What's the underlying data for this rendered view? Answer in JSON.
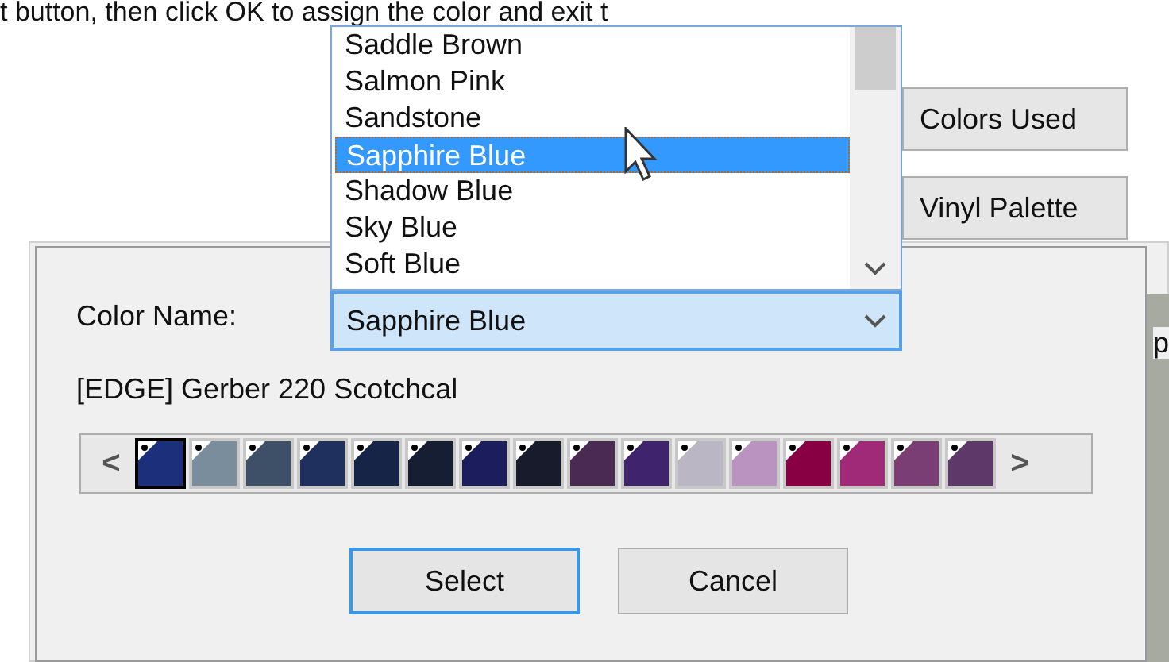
{
  "instruction_text": "t button, then click OK to assign the color and exit t",
  "background_buttons": [
    {
      "label": "Colors Used"
    },
    {
      "label": "Vinyl Palette"
    }
  ],
  "background_fragment": "p",
  "dropdown": {
    "items": [
      {
        "label": "Saddle Brown",
        "selected": false
      },
      {
        "label": "Salmon Pink",
        "selected": false
      },
      {
        "label": "Sandstone",
        "selected": false
      },
      {
        "label": "Sapphire Blue",
        "selected": true
      },
      {
        "label": "Shadow Blue",
        "selected": false
      },
      {
        "label": "Sky Blue",
        "selected": false
      },
      {
        "label": "Soft Blue",
        "selected": false
      }
    ]
  },
  "dialog": {
    "color_name_label": "Color Name:",
    "color_name_value": "Sapphire Blue",
    "palette_name": "[EDGE] Gerber 220 Scotchcal",
    "scroll_left": "<",
    "scroll_right": ">",
    "swatches": [
      {
        "color": "#1b2f7a",
        "selected": true
      },
      {
        "color": "#7a8d9c",
        "selected": false
      },
      {
        "color": "#3e5068",
        "selected": false
      },
      {
        "color": "#1f2f5e",
        "selected": false
      },
      {
        "color": "#152447",
        "selected": false
      },
      {
        "color": "#151e33",
        "selected": false
      },
      {
        "color": "#1b1d5c",
        "selected": false
      },
      {
        "color": "#181b2b",
        "selected": false
      },
      {
        "color": "#4a2a52",
        "selected": false
      },
      {
        "color": "#40236d",
        "selected": false
      },
      {
        "color": "#bab6c4",
        "selected": false
      },
      {
        "color": "#bb93c0",
        "selected": false
      },
      {
        "color": "#880043",
        "selected": false
      },
      {
        "color": "#a02a78",
        "selected": false
      },
      {
        "color": "#7a3e75",
        "selected": false
      },
      {
        "color": "#5e3868",
        "selected": false
      }
    ],
    "buttons": [
      {
        "label": "Select",
        "default": true
      },
      {
        "label": "Cancel",
        "default": false
      }
    ]
  }
}
